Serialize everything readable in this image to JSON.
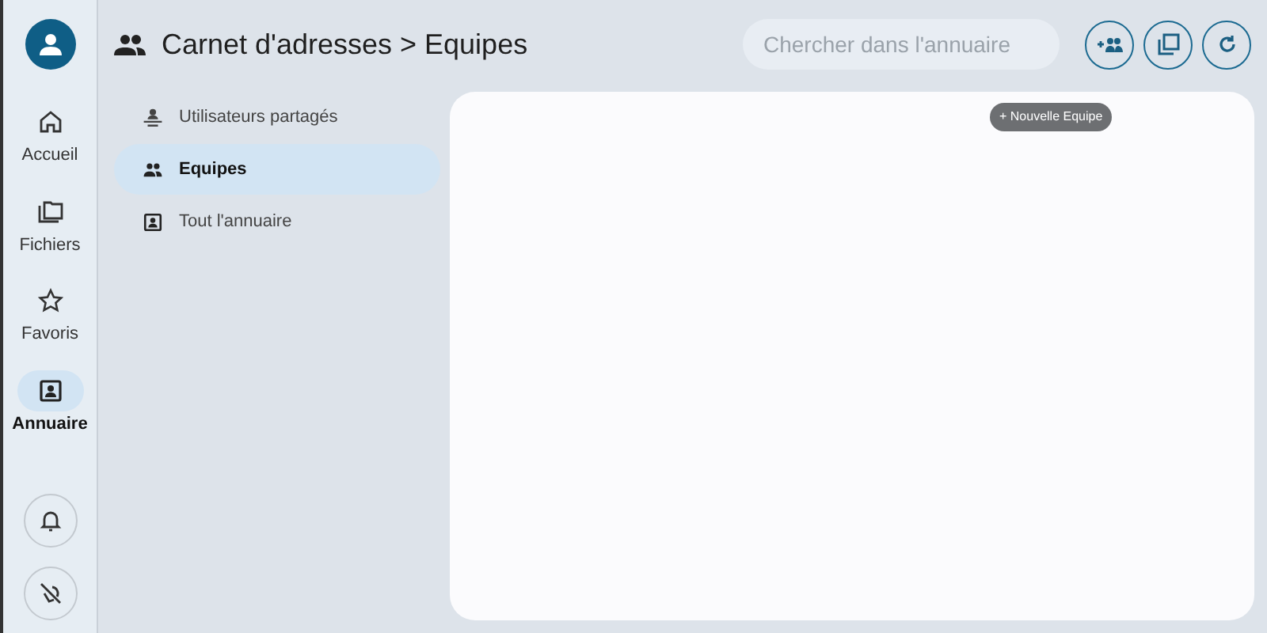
{
  "rail": {
    "items": [
      {
        "kind": "home",
        "label": "Accueil",
        "selected": false
      },
      {
        "kind": "folder",
        "label": "Fichiers",
        "selected": false
      },
      {
        "kind": "star",
        "label": "Favoris",
        "selected": false
      },
      {
        "kind": "contact",
        "label": "Annuaire",
        "selected": true
      }
    ]
  },
  "header": {
    "title": "Carnet d'adresses > Equipes"
  },
  "search": {
    "placeholder": "Chercher dans l'annuaire"
  },
  "tooltip": "+ Nouvelle Equipe",
  "sidebar": {
    "items": [
      {
        "kind": "shared",
        "label": "Utilisateurs partagés",
        "selected": false
      },
      {
        "kind": "group",
        "label": "Equipes",
        "selected": true
      },
      {
        "kind": "contact",
        "label": "Tout l'annuaire",
        "selected": false
      }
    ]
  }
}
